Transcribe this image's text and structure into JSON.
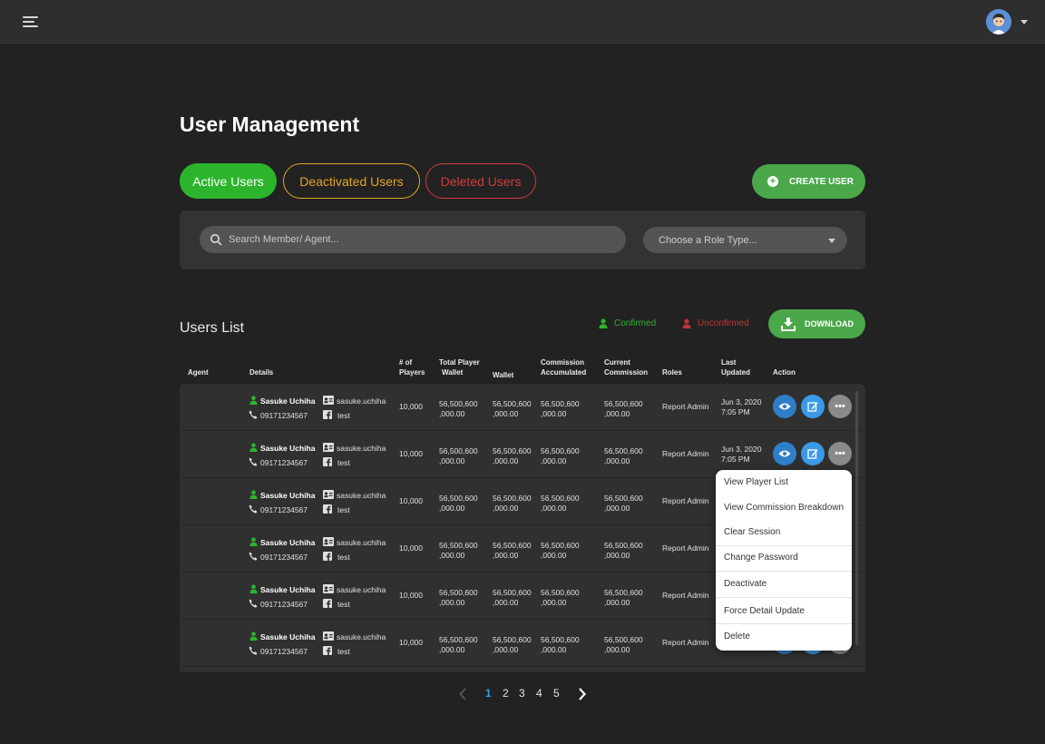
{
  "header": {
    "menu_icon": "hamburger-icon",
    "avatar_icon": "user-avatar-icon"
  },
  "page": {
    "title": "User Management"
  },
  "tabs": [
    {
      "label": "Active Users",
      "color": "#2cb52c"
    },
    {
      "label": "Deactivated Users",
      "color": "#e0a52a"
    },
    {
      "label": "Deleted Users",
      "color": "#d13c3c"
    }
  ],
  "create_user": {
    "label": "CREATE USER"
  },
  "filters": {
    "search_placeholder": "Search Member/ Agent...",
    "role_select": "Choose a Role Type..."
  },
  "users_list": {
    "title": "Users List",
    "legend_confirmed": "Confirmed",
    "legend_unconfirmed": "Unconfirmed",
    "download_label": "DOWNLOAD",
    "columns": {
      "agent": "Agent",
      "details": "Details",
      "players_1": "# of",
      "players_2": "Players",
      "total_wallet_1": "Total Player",
      "total_wallet_2": "Wallet",
      "wallet": "Wallet",
      "commission_acc_1": "Commission",
      "commission_acc_2": "Accumulated",
      "current_comm_1": "Current",
      "current_comm_2": "Commission",
      "roles": "Roles",
      "last_updated_1": "Last",
      "last_updated_2": "Updated",
      "action": "Action"
    },
    "rows": [
      {
        "name": "Sasuke Uchiha",
        "username": "sasuke.uchiha",
        "phone": "09171234567",
        "facebook": "test",
        "players": "10,000",
        "total_wallet_1": "56,500,600",
        "total_wallet_2": ",000.00",
        "wallet_1": "56,500,600",
        "wallet_2": ",000.00",
        "comm_acc_1": "56,500,600",
        "comm_acc_2": ",000.00",
        "curr_comm_1": "56,500,600",
        "curr_comm_2": ",000.00",
        "role": "Report Admin",
        "updated_1": "Jun 3, 2020",
        "updated_2": "7:05 PM"
      },
      {
        "name": "Sasuke Uchiha",
        "username": "sasuke.uchiha",
        "phone": "09171234567",
        "facebook": "test",
        "players": "10,000",
        "total_wallet_1": "56,500,600",
        "total_wallet_2": ",000.00",
        "wallet_1": "56,500,600",
        "wallet_2": ",000.00",
        "comm_acc_1": "56,500,600",
        "comm_acc_2": ",000.00",
        "curr_comm_1": "56,500,600",
        "curr_comm_2": ",000.00",
        "role": "Report Admin",
        "updated_1": "Jun 3, 2020",
        "updated_2": "7:05 PM"
      },
      {
        "name": "Sasuke Uchiha",
        "username": "sasuke.uchiha",
        "phone": "09171234567",
        "facebook": "test",
        "players": "10,000",
        "total_wallet_1": "56,500,600",
        "total_wallet_2": ",000.00",
        "wallet_1": "56,500,600",
        "wallet_2": ",000.00",
        "comm_acc_1": "56,500,600",
        "comm_acc_2": ",000.00",
        "curr_comm_1": "56,500,600",
        "curr_comm_2": ",000.00",
        "role": "Report Admin",
        "updated_1": "",
        "updated_2": ""
      },
      {
        "name": "Sasuke Uchiha",
        "username": "sasuke.uchiha",
        "phone": "09171234567",
        "facebook": "test",
        "players": "10,000",
        "total_wallet_1": "56,500,600",
        "total_wallet_2": ",000.00",
        "wallet_1": "56,500,600",
        "wallet_2": ",000.00",
        "comm_acc_1": "56,500,600",
        "comm_acc_2": ",000.00",
        "curr_comm_1": "56,500,600",
        "curr_comm_2": ",000.00",
        "role": "Report Admin",
        "updated_1": "",
        "updated_2": ""
      },
      {
        "name": "Sasuke Uchiha",
        "username": "sasuke.uchiha",
        "phone": "09171234567",
        "facebook": "test",
        "players": "10,000",
        "total_wallet_1": "56,500,600",
        "total_wallet_2": ",000.00",
        "wallet_1": "56,500,600",
        "wallet_2": ",000.00",
        "comm_acc_1": "56,500,600",
        "comm_acc_2": ",000.00",
        "curr_comm_1": "56,500,600",
        "curr_comm_2": ",000.00",
        "role": "Report Admin",
        "updated_1": "",
        "updated_2": ""
      },
      {
        "name": "Sasuke Uchiha",
        "username": "sasuke.uchiha",
        "phone": "09171234567",
        "facebook": "test",
        "players": "10,000",
        "total_wallet_1": "56,500,600",
        "total_wallet_2": ",000.00",
        "wallet_1": "56,500,600",
        "wallet_2": ",000.00",
        "comm_acc_1": "56,500,600",
        "comm_acc_2": ",000.00",
        "curr_comm_1": "56,500,600",
        "curr_comm_2": ",000.00",
        "role": "Report Admin",
        "updated_1": "",
        "updated_2": ""
      }
    ]
  },
  "action_menu": {
    "items": [
      "View Player List",
      "View Commission Breakdown",
      "Clear Session",
      "Change Password",
      "Deactivate",
      "Force Detail Update",
      "Delete"
    ]
  },
  "pagination": {
    "pages": [
      "1",
      "2",
      "3",
      "4",
      "5"
    ],
    "current": "1"
  }
}
